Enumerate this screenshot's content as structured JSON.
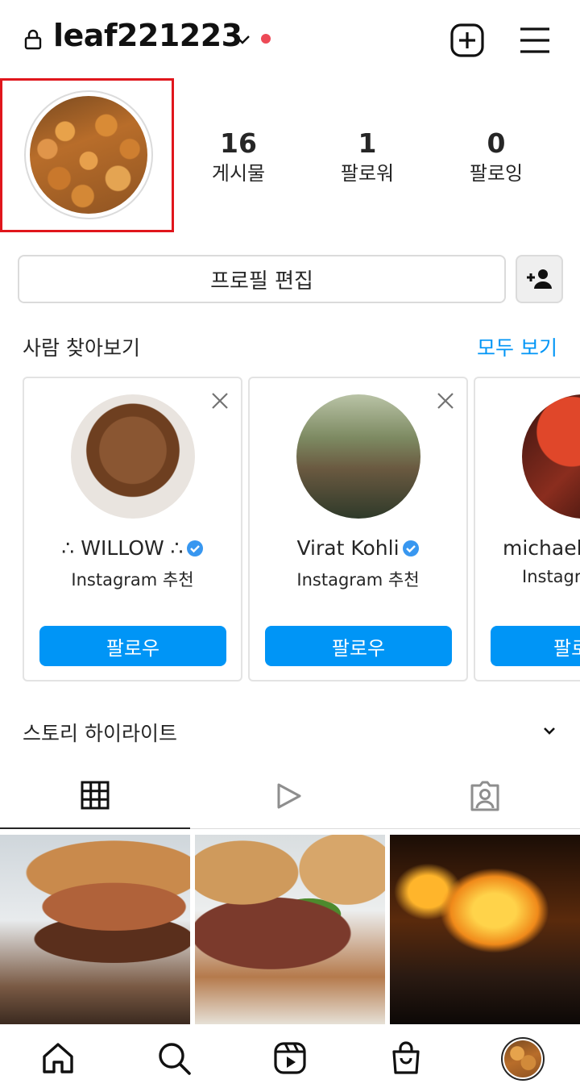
{
  "header": {
    "username": "leaf221223"
  },
  "profile": {
    "stats": [
      {
        "value": "16",
        "label": "게시물"
      },
      {
        "value": "1",
        "label": "팔로워"
      },
      {
        "value": "0",
        "label": "팔로잉"
      }
    ],
    "edit_button": "프로필 편집"
  },
  "discover": {
    "title": "사람 찾아보기",
    "see_all": "모두 보기",
    "cards": [
      {
        "name": "∴ WILLOW ∴",
        "verified": true,
        "subtitle": "Instagram 추천",
        "follow": "팔로우"
      },
      {
        "name": "Virat Kohli",
        "verified": true,
        "subtitle": "Instagram 추천",
        "follow": "팔로우"
      },
      {
        "name": "michael",
        "verified": false,
        "subtitle": "Instagr",
        "follow": "팔로"
      }
    ]
  },
  "highlights": {
    "title": "스토리 하이라이트"
  },
  "colors": {
    "accent": "#0095f6",
    "notification_dot": "#ed4956",
    "highlight_box": "#e0161c",
    "verified_badge": "#3897f0"
  },
  "icons": {
    "header": [
      "lock-icon",
      "chevron-down-icon",
      "new-post-icon",
      "menu-icon"
    ],
    "tabs": [
      "grid-icon",
      "reels-icon",
      "tagged-icon"
    ],
    "nav": [
      "home-icon",
      "search-icon",
      "reels-icon",
      "shop-icon",
      "profile-avatar"
    ]
  }
}
